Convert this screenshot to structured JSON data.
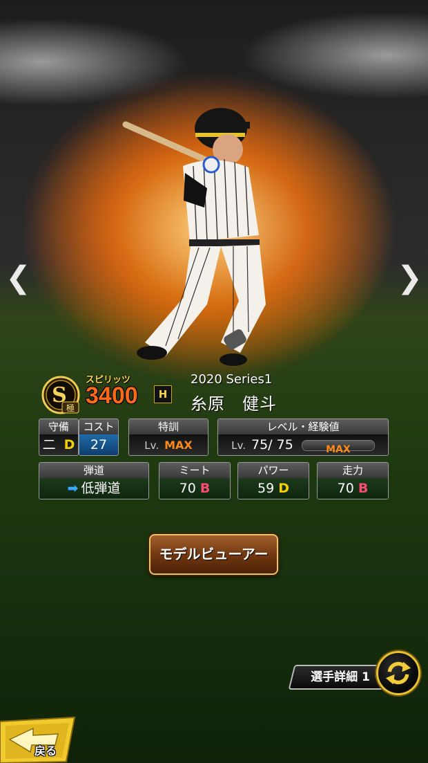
{
  "card": {
    "series": "2020 Series1",
    "player_name": "糸原　健斗",
    "rank_letter": "S",
    "rank_sub": "極",
    "spirit_label": "スピリッツ",
    "spirit_value": "3400",
    "team_logo": "H"
  },
  "stats_row1": {
    "position_head": "守備",
    "position_value": "二",
    "position_grade": "D",
    "cost_head": "コスト",
    "cost_value": "27",
    "training_head": "特訓",
    "training_lv": "Lv.",
    "training_value": "MAX",
    "level_head": "レベル・経験値",
    "level_lv": "Lv.",
    "level_value": "75/  75",
    "exp_value": "MAX",
    "exp_fill": 1.0
  },
  "stats_row2": {
    "trajectory_head": "弾道",
    "trajectory_value": "低弾道",
    "contact_head": "ミート",
    "contact_value": "70",
    "contact_grade": "B",
    "power_head": "パワー",
    "power_value": "59",
    "power_grade": "D",
    "speed_head": "走力",
    "speed_value": "70",
    "speed_grade": "B"
  },
  "buttons": {
    "model_viewer": "モデルビューアー",
    "player_detail": "選手詳細 1",
    "back": "戻る"
  },
  "nav": {
    "prev": "❮",
    "next": "❯"
  },
  "colors": {
    "accent_orange": "#ff8a1a",
    "grade_b": "#ff4c72",
    "grade_d": "#f4d000",
    "gold": "#e8c230"
  },
  "icons": [
    "chevron-left-icon",
    "chevron-right-icon",
    "rank-s-badge-icon",
    "team-logo-icon",
    "swap-icon",
    "back-arrow-icon",
    "right-arrow-icon"
  ]
}
